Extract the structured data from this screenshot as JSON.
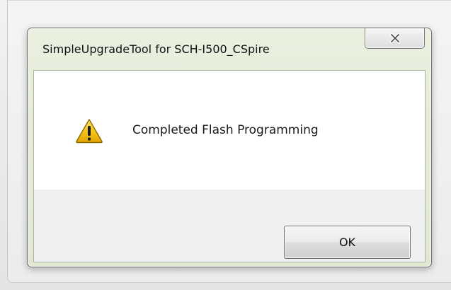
{
  "dialog": {
    "title": "SimpleUpgradeTool for SCH-I500_CSpire",
    "message": "Completed Flash Programming",
    "icon": "warning-icon",
    "close_icon": "close-icon",
    "ok_label": "OK"
  },
  "colors": {
    "frame_tint": "#e6ecd9",
    "warning_fill": "#f6c21a",
    "warning_outline": "#8a6a00"
  }
}
